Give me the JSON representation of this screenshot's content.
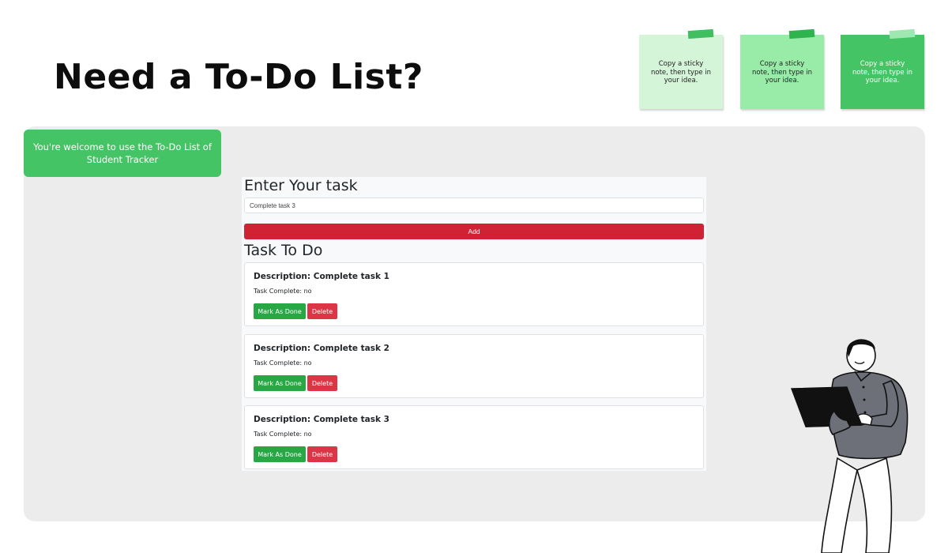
{
  "page": {
    "title": "Need a To-Do List?"
  },
  "sticky_notes": [
    {
      "text": "Copy a sticky note, then type in your idea.",
      "color": "#d5f5d8",
      "tape_color": "#3fbf5f",
      "text_color": "#222222"
    },
    {
      "text": "Copy a sticky note, then type in your idea.",
      "color": "#98eca8",
      "tape_color": "#2eb34f",
      "text_color": "#222222"
    },
    {
      "text": "Copy a sticky note, then type in your idea.",
      "color": "#45c466",
      "tape_color": "#9fe7b0",
      "text_color": "#ffffff"
    }
  ],
  "welcome": {
    "text": "You're welcome to use the To-Do List of Student Tracker"
  },
  "app": {
    "enter_heading": "Enter Your task",
    "input_value": "Complete task 3",
    "add_label": "Add",
    "tasks_heading": "Task To Do",
    "tasks": [
      {
        "description": "Description: Complete task 1",
        "status": "Task Complete: no",
        "done_label": "Mark As Done",
        "delete_label": "Delete"
      },
      {
        "description": "Description: Complete task 2",
        "status": "Task Complete: no",
        "done_label": "Mark As Done",
        "delete_label": "Delete"
      },
      {
        "description": "Description: Complete task 3",
        "status": "Task Complete: no",
        "done_label": "Mark As Done",
        "delete_label": "Delete"
      }
    ]
  },
  "colors": {
    "accent_green": "#45c466",
    "add_red": "#cf2234",
    "done_green": "#28a745",
    "delete_red": "#dc3545",
    "panel_gray": "#ececec"
  }
}
